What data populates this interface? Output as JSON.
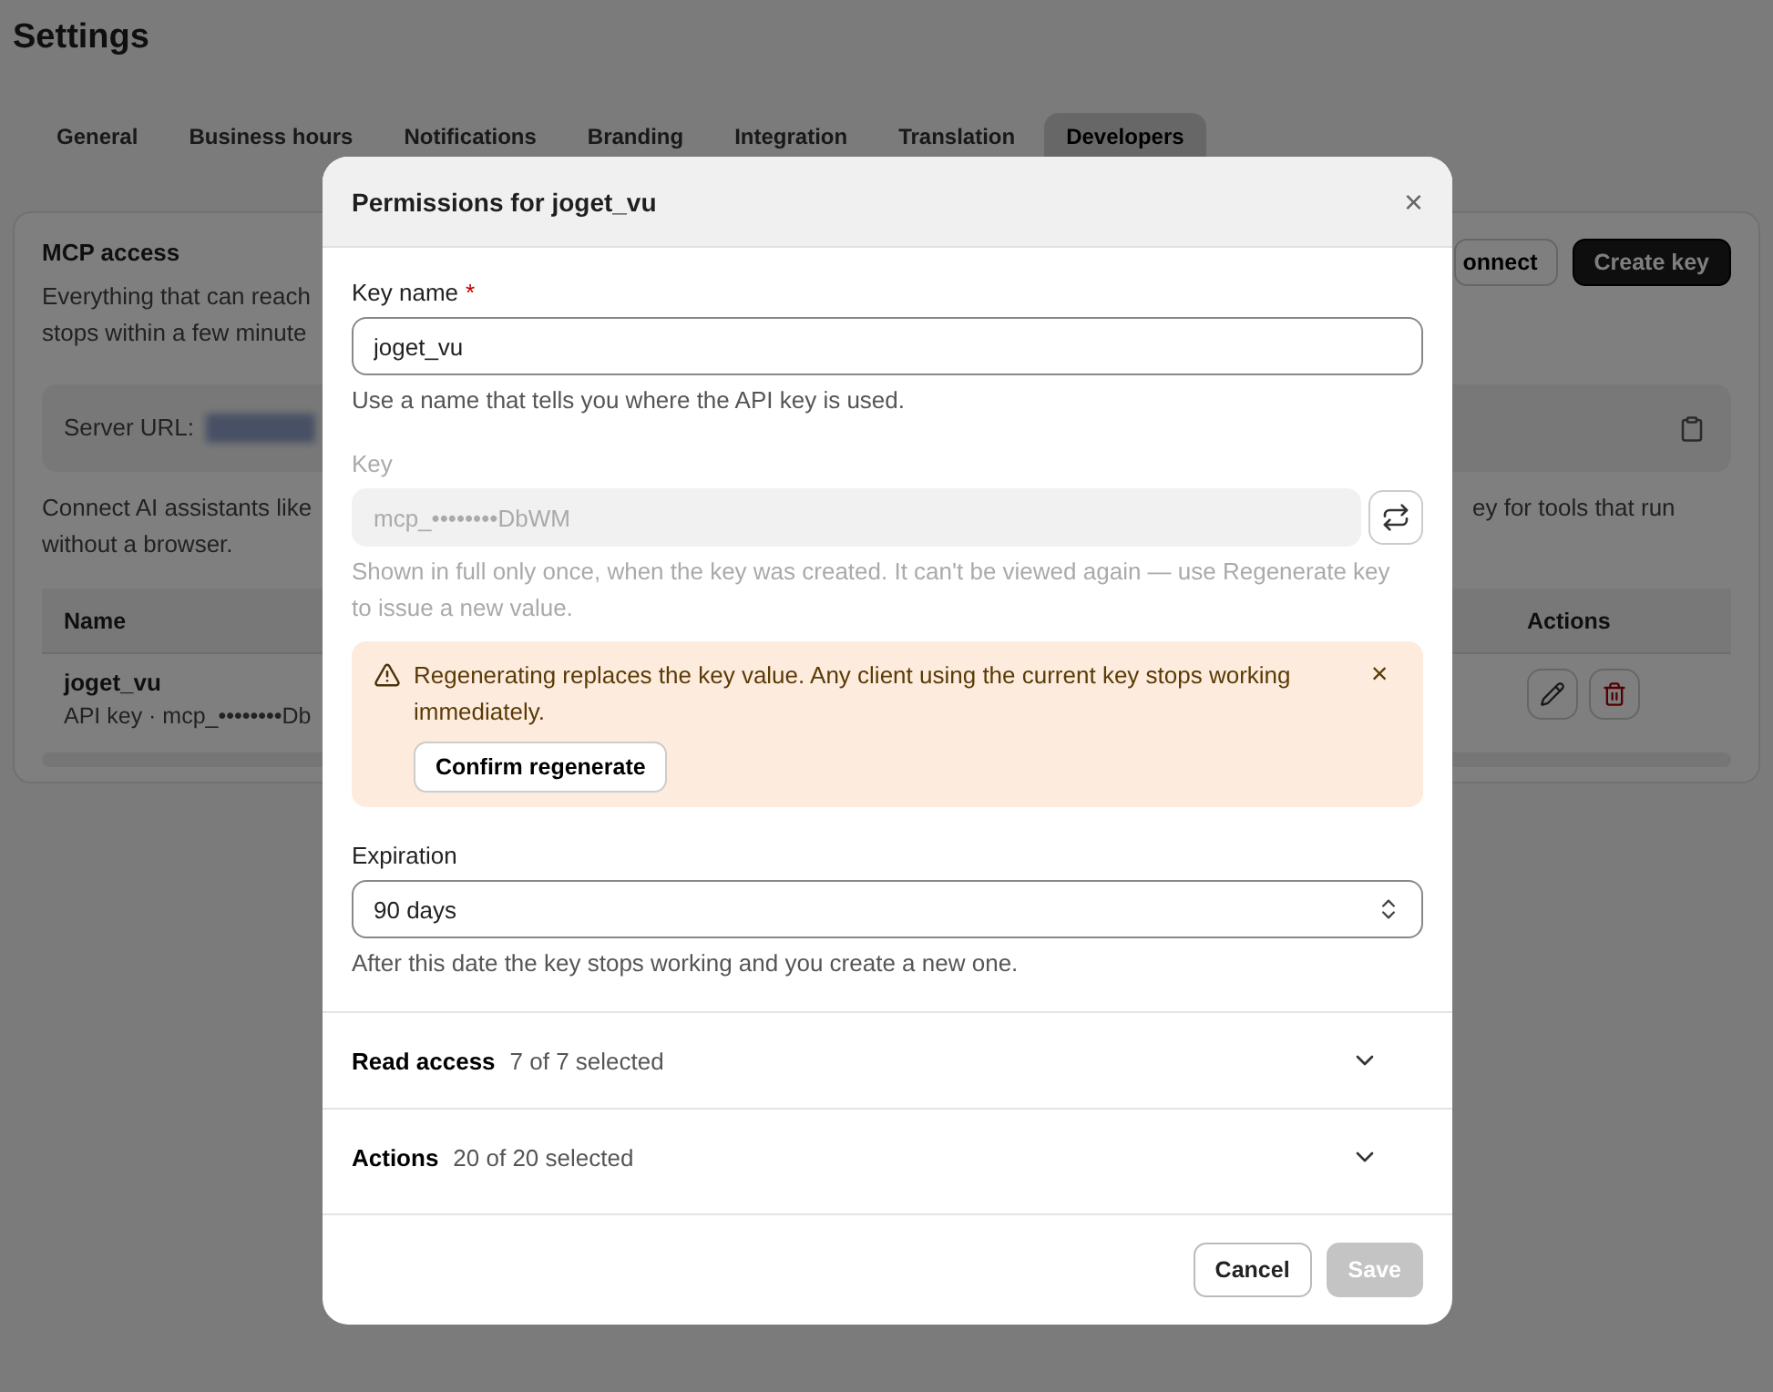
{
  "page": {
    "title": "Settings"
  },
  "tabs": [
    {
      "label": "General",
      "selected": false
    },
    {
      "label": "Business hours",
      "selected": false
    },
    {
      "label": "Notifications",
      "selected": false
    },
    {
      "label": "Branding",
      "selected": false
    },
    {
      "label": "Integration",
      "selected": false
    },
    {
      "label": "Translation",
      "selected": false
    },
    {
      "label": "Developers",
      "selected": true
    }
  ],
  "mcp_card": {
    "title": "MCP access",
    "description_lines": [
      "Everything that can reach",
      "stops within a few minute"
    ],
    "connect_button": "onnect",
    "create_button": "Create key",
    "server_label": "Server URL:",
    "connect_lines": [
      "Connect AI assistants like",
      "without a browser."
    ],
    "connect_tail": "ey for tools that run",
    "columns": [
      "Name",
      "Actions"
    ],
    "rows": [
      {
        "name": "joget_vu",
        "detail": "API key · mcp_••••••••Db"
      }
    ]
  },
  "dialog": {
    "title": "Permissions for joget_vu",
    "close": "×",
    "key_name": {
      "label": "Key name",
      "required_mark": "*",
      "value": "joget_vu",
      "hint": "Use a name that tells you where the API key is used."
    },
    "key": {
      "label": "Key",
      "value": "mcp_••••••••DbWM",
      "disabled": true,
      "hint": "Shown in full only once, when the key was created. It can't be viewed again — use Regenerate key to issue a new value."
    },
    "warning": {
      "text": "Regenerating replaces the key value. Any client using the current key stops working immediately.",
      "close": "×",
      "button": "Confirm regenerate"
    },
    "expiration": {
      "label": "Expiration",
      "value": "90 days",
      "hint": "After this date the key stops working and you create a new one."
    },
    "sections": [
      {
        "title": "Read access",
        "count": "7 of 7 selected",
        "expanded": false
      },
      {
        "title": "Actions",
        "count": "20 of 20 selected",
        "expanded": false
      }
    ],
    "buttons": [
      {
        "label": "Cancel",
        "kind": "secondary",
        "disabled": false
      },
      {
        "label": "Save",
        "kind": "primary",
        "disabled": true
      }
    ]
  }
}
